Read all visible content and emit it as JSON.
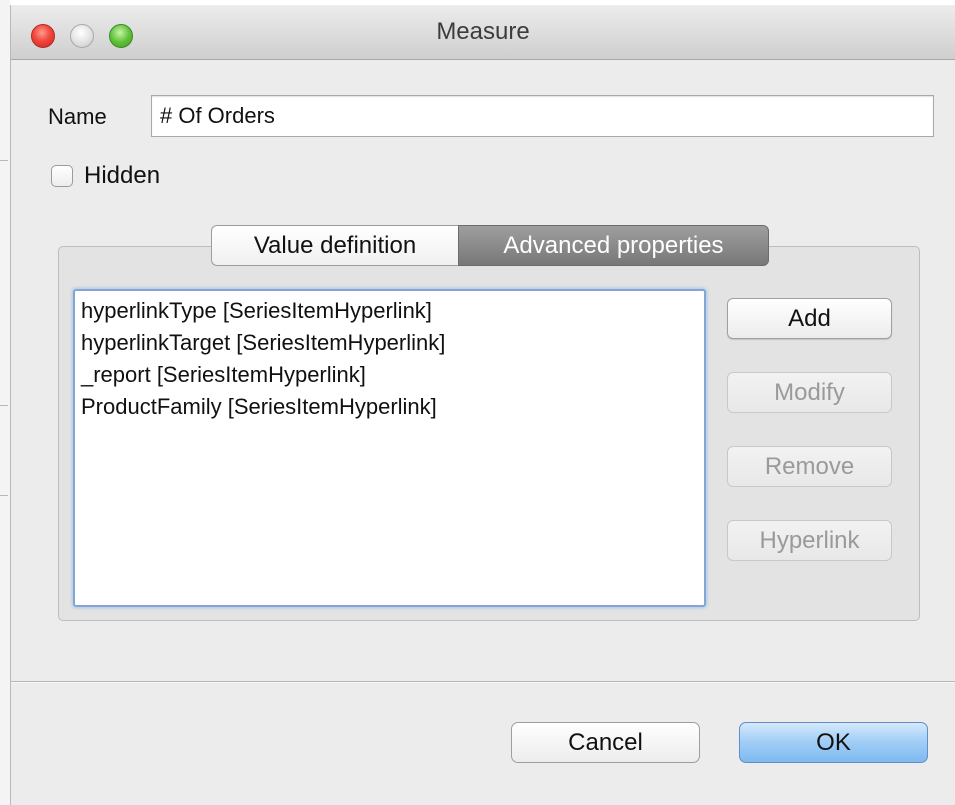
{
  "window": {
    "title": "Measure"
  },
  "name_field": {
    "label": "Name",
    "value": "# Of Orders"
  },
  "hidden_checkbox": {
    "label": "Hidden",
    "checked": false
  },
  "tabs": [
    {
      "label": "Value definition",
      "active": false
    },
    {
      "label": "Advanced properties",
      "active": true
    }
  ],
  "properties": {
    "items": [
      "hyperlinkType [SeriesItemHyperlink]",
      "hyperlinkTarget [SeriesItemHyperlink]",
      "_report [SeriesItemHyperlink]",
      "ProductFamily [SeriesItemHyperlink]"
    ]
  },
  "side_buttons": {
    "add": "Add",
    "modify": "Modify",
    "remove": "Remove",
    "hyperlink": "Hyperlink"
  },
  "footer": {
    "cancel": "Cancel",
    "ok": "OK"
  },
  "colors": {
    "window_background": "#ececec",
    "active_tab": "#8a8a8a",
    "list_focus_ring": "#82a7d4",
    "default_button": "#9fcdf6",
    "close_button": "#f2473c",
    "minimize_button": "#d6d6d6",
    "zoom_button": "#61c23b"
  },
  "icons": {
    "close": "close-icon",
    "minimize": "minimize-icon",
    "zoom": "zoom-icon"
  }
}
